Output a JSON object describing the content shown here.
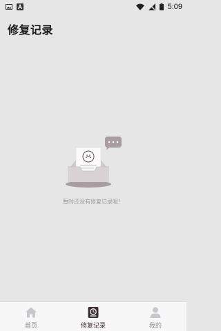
{
  "status_bar": {
    "left_icons": [
      "image-icon",
      "a-badge-icon"
    ],
    "right_icons": [
      "wifi-icon",
      "signal-off-icon",
      "battery-icon"
    ],
    "time": "5:09"
  },
  "header": {
    "title": "修复记录"
  },
  "empty_state": {
    "illustration": "inbox-document-chat-icon",
    "message": "暂时还没有修复记录呢！"
  },
  "bottom_nav": {
    "items": [
      {
        "label": "首页",
        "icon": "home-icon",
        "active": false
      },
      {
        "label": "修复记录",
        "icon": "history-icon",
        "active": true
      },
      {
        "label": "我的",
        "icon": "user-icon",
        "active": false
      }
    ],
    "active_color": "#3a2e33",
    "inactive_color": "#c8c8cc"
  }
}
